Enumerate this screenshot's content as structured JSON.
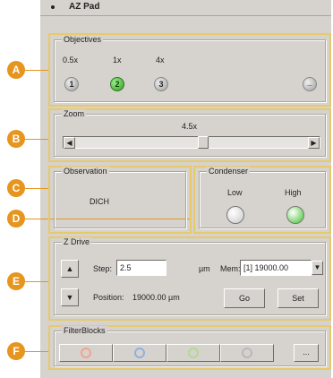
{
  "window": {
    "title": "AZ Pad"
  },
  "objectives": {
    "label": "Objectives",
    "magnifications": [
      "0.5x",
      "1x",
      "4x"
    ],
    "buttons": [
      "1",
      "2",
      "3"
    ],
    "active_index": 1,
    "eject_label": "_"
  },
  "zoom": {
    "label": "Zoom",
    "value": "4.5x",
    "left_arrow": "◀",
    "right_arrow": "▶",
    "level": 0.58
  },
  "observation": {
    "label": "Observation",
    "value": "DICH"
  },
  "condenser": {
    "label": "Condenser",
    "low_label": "Low",
    "high_label": "High",
    "low_color": "#c8c8c8",
    "high_color": "#3ec22b",
    "active": "High"
  },
  "zdrive": {
    "label": "Z Drive",
    "step_label": "Step:",
    "step_value": "2.5",
    "step_unit": "µm",
    "mem_label": "Mem:",
    "mem_value": "[1] 19000.00",
    "position_label": "Position:",
    "position_value": "19000.00 µm",
    "go_label": "Go",
    "set_label": "Set",
    "up_icon": "▲",
    "down_icon": "▼",
    "dropdown_icon": "▼"
  },
  "filterblocks": {
    "label": "FilterBlocks",
    "rings": [
      "#f2a391",
      "#93aee0",
      "#b2d98e",
      "#b8b8b8"
    ],
    "more_label": "..."
  },
  "callouts": [
    "A",
    "B",
    "C",
    "D",
    "E",
    "F"
  ],
  "colors": {
    "callout": "#e6951e",
    "outline": "#e8c96a",
    "panel": "#d6d3ce"
  }
}
